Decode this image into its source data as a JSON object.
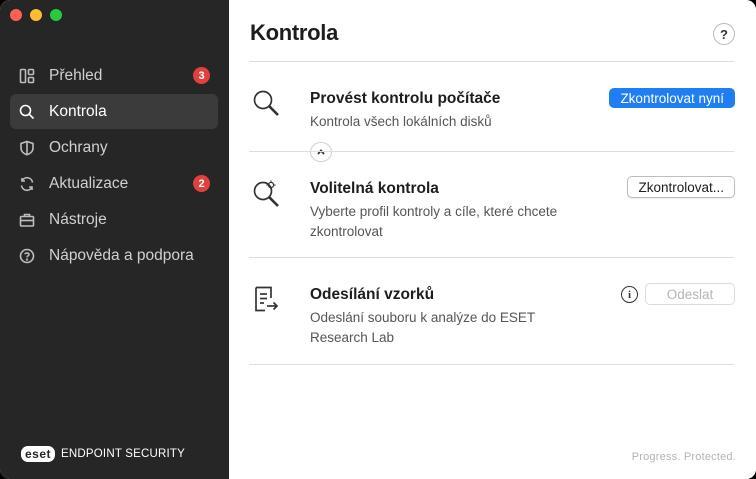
{
  "window": {
    "traffic_lights": [
      "close",
      "minimize",
      "maximize"
    ]
  },
  "sidebar": {
    "items": [
      {
        "label": "Přehled",
        "icon": "dashboard-icon",
        "badge": "3",
        "active": false
      },
      {
        "label": "Kontrola",
        "icon": "search-icon",
        "badge": null,
        "active": true
      },
      {
        "label": "Ochrany",
        "icon": "shield-icon",
        "badge": null,
        "active": false
      },
      {
        "label": "Aktualizace",
        "icon": "refresh-icon",
        "badge": "2",
        "active": false
      },
      {
        "label": "Nástroje",
        "icon": "briefcase-icon",
        "badge": null,
        "active": false
      },
      {
        "label": "Nápověda a podpora",
        "icon": "help-circle-icon",
        "badge": null,
        "active": false
      }
    ],
    "brand": {
      "logo": "eset",
      "text": "ENDPOINT SECURITY"
    }
  },
  "main": {
    "title": "Kontrola",
    "help_label": "?",
    "rows": [
      {
        "title": "Provést kontrolu počítače",
        "description": "Kontrola všech lokálních disků",
        "button": "Zkontrolovat nyní"
      },
      {
        "title": "Volitelná kontrola",
        "description": "Vyberte profil kontroly a cíle, které chcete zkontrolovat",
        "button": "Zkontrolovat..."
      },
      {
        "title": "Odesílání vzorků",
        "description": "Odeslání souboru k analýze do ESET Research Lab",
        "button": "Odeslat",
        "info": "i"
      }
    ],
    "tagline": "Progress. Protected."
  },
  "colors": {
    "accent": "#1f7ef2",
    "sidebar_bg": "#262626",
    "badge": "#e0413c"
  }
}
